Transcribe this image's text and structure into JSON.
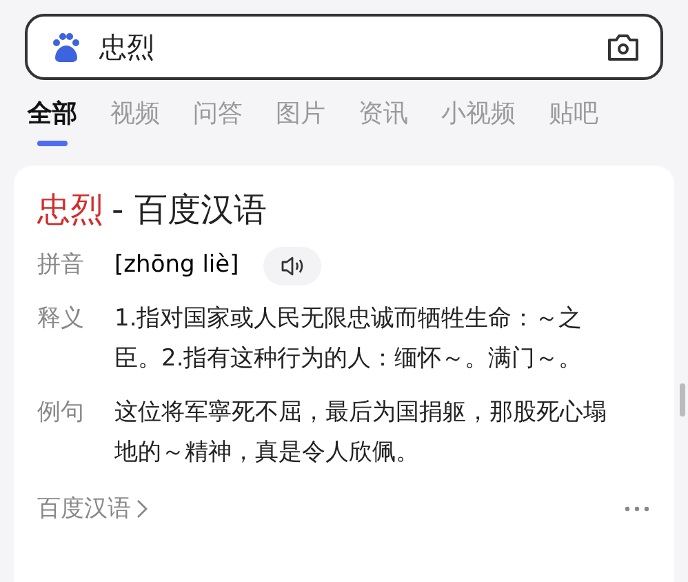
{
  "search": {
    "value": "忠烈"
  },
  "tabs": [
    {
      "label": "全部",
      "selected": true
    },
    {
      "label": "视频",
      "selected": false
    },
    {
      "label": "问答",
      "selected": false
    },
    {
      "label": "图片",
      "selected": false
    },
    {
      "label": "资讯",
      "selected": false
    },
    {
      "label": "小视频",
      "selected": false
    },
    {
      "label": "贴吧",
      "selected": false
    }
  ],
  "card": {
    "term": "忠烈",
    "source": "- 百度汉语",
    "rows": [
      {
        "kind": "pinyin",
        "label": "拼音",
        "text": "[zhōng liè]"
      },
      {
        "kind": "text",
        "label": "释义",
        "text": "1.指对国家或人民无限忠诚而牺牲生命：～之臣。2.指有这种行为的人：缅怀～。满门～。"
      },
      {
        "kind": "text",
        "label": "例句",
        "text": "这位将军寧死不屈，最后为国捐躯，那股死心塌地的～精神，真是令人欣佩。"
      }
    ],
    "footer": "百度汉语"
  }
}
